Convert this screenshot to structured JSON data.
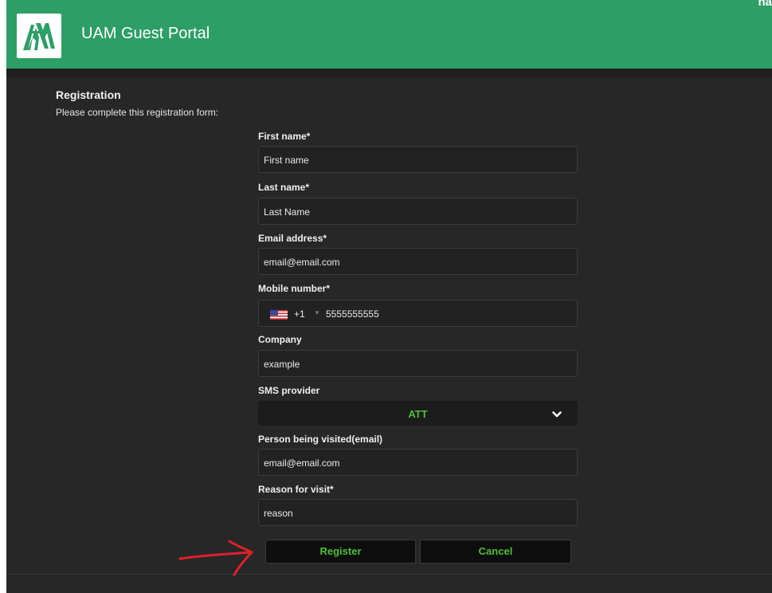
{
  "header": {
    "title": "UAM Guest Portal",
    "corner_text": "na",
    "logo": "uam-logo",
    "background_color": "#2d9e65"
  },
  "registration": {
    "title": "Registration",
    "subtitle": "Please complete this registration form:"
  },
  "form": {
    "first_name": {
      "label": "First name*",
      "value": "First name"
    },
    "last_name": {
      "label": "Last name*",
      "value": "Last Name"
    },
    "email": {
      "label": "Email address*",
      "value": "email@email.com"
    },
    "mobile": {
      "label": "Mobile number*",
      "country_flag": "us-flag-icon",
      "dial_code": "+1",
      "value": "5555555555"
    },
    "company": {
      "label": "Company",
      "value": "example"
    },
    "sms_provider": {
      "label": "SMS provider",
      "selected": "ATT"
    },
    "person_visited": {
      "label": "Person being visited(email)",
      "value": "email@email.com"
    },
    "reason": {
      "label": "Reason for visit*",
      "value": "reason"
    }
  },
  "buttons": {
    "register": "Register",
    "cancel": "Cancel"
  },
  "colors": {
    "accent_green": "#4fbf3a",
    "panel_background": "#272727",
    "annotation_red": "#e0202a"
  }
}
